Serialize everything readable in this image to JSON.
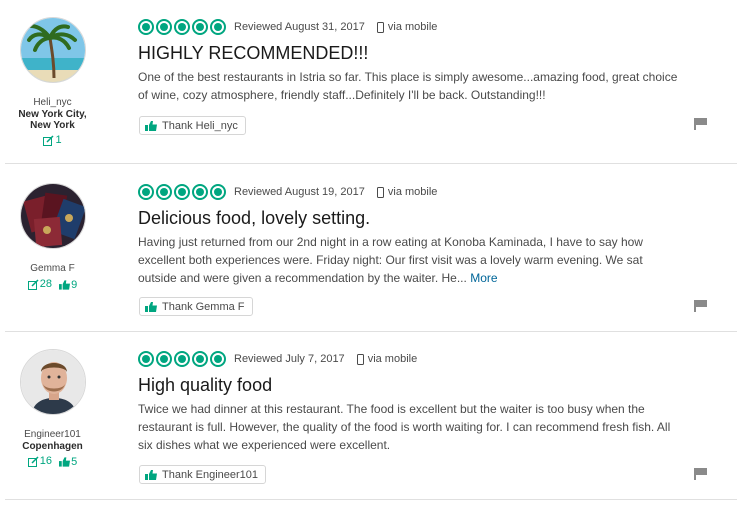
{
  "reviews": [
    {
      "user": {
        "name": "Heli_nyc",
        "location_line1": "New York City,",
        "location_line2": "New York",
        "review_count": "1",
        "helpful_count": ""
      },
      "reviewed": "Reviewed August 31, 2017",
      "via": "via mobile",
      "title": "HIGHLY RECOMMENDED!!!",
      "body": "One of the best restaurants in Istria so far. This place is simply awesome...amazing food, great choice of wine, cozy atmosphere, friendly staff...Definitely I'll be back. Outstanding!!!",
      "more": "",
      "thank": "Thank Heli_nyc",
      "rating": 5
    },
    {
      "user": {
        "name": "Gemma F",
        "location_line1": "",
        "location_line2": "",
        "review_count": "28",
        "helpful_count": "9"
      },
      "reviewed": "Reviewed August 19, 2017",
      "via": "via mobile",
      "title": "Delicious food, lovely setting.",
      "body": "Having just returned from our 2nd night in a row eating at Konoba Kaminada, I have to say how excellent both experiences were. Friday night: Our first visit was a lovely warm evening. We sat outside and were given a recommendation by the waiter. He...",
      "more": "More",
      "thank": "Thank Gemma F",
      "rating": 5
    },
    {
      "user": {
        "name": "Engineer101",
        "location_line1": "Copenhagen",
        "location_line2": "",
        "review_count": "16",
        "helpful_count": "5"
      },
      "reviewed": "Reviewed July 7, 2017",
      "via": "via mobile",
      "title": "High quality food",
      "body": "Twice we had dinner at this restaurant. The food is excellent but the waiter is too busy when the restaurant is full. However, the quality of the food is worth waiting for. I can recommend fresh fish. All six dishes what we experienced were excellent.",
      "more": "",
      "thank": "Thank Engineer101",
      "rating": 5
    }
  ],
  "colors": {
    "accent": "#00a680",
    "link": "#006699",
    "text": "#4a4a4a",
    "title": "#1a1a1a"
  },
  "icons": {
    "review_count": "pencil-box-icon",
    "helpful_count": "thumbs-up-icon",
    "via": "mobile-phone-icon",
    "thank": "thumbs-up-icon",
    "flag": "flag-icon"
  }
}
